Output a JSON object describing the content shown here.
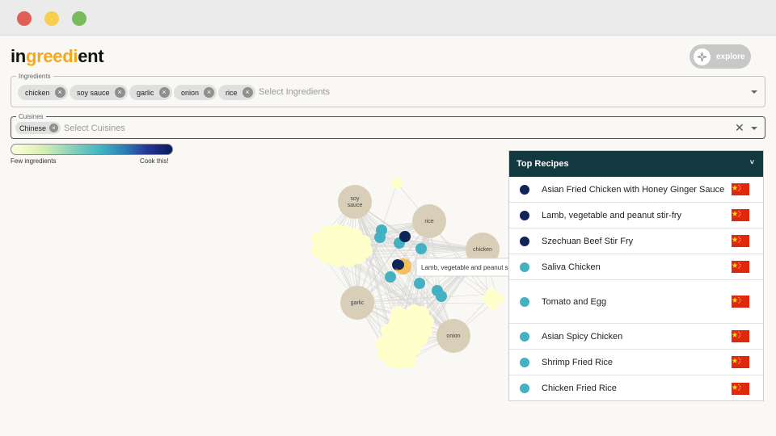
{
  "window": {
    "controls": [
      "close",
      "minimize",
      "maximize"
    ]
  },
  "logo": {
    "part1": "in",
    "part2": "greedi",
    "part3": "ent"
  },
  "explore_button": {
    "label": "explore",
    "icon": "sparkle-icon"
  },
  "ingredients": {
    "legend": "Ingredients",
    "chips": [
      "chicken",
      "soy sauce",
      "garlic",
      "onion",
      "rice"
    ],
    "placeholder": "Select Ingredients"
  },
  "cuisines": {
    "legend": "Cuisines",
    "chips": [
      "Chinese"
    ],
    "placeholder": "Select Cuisines"
  },
  "color_legend": {
    "low_label": "Few ingredients",
    "high_label": "Cook this!"
  },
  "graph": {
    "ingredient_nodes": [
      "soy sauce",
      "rice",
      "chicken",
      "garlic",
      "onion"
    ],
    "tooltip": "Lamb, vegetable and peanut s"
  },
  "top_recipes": {
    "title": "Top Recipes",
    "items": [
      {
        "name": "Asian Fried Chicken with Honey Ginger Sauce",
        "color": "#0f2557"
      },
      {
        "name": "Lamb, vegetable and peanut stir-fry",
        "color": "#0f2557"
      },
      {
        "name": "Szechuan Beef Stir Fry",
        "color": "#0f2557"
      },
      {
        "name": "Saliva Chicken",
        "color": "#44b1c2"
      },
      {
        "name": "Tomato and Egg",
        "color": "#44b1c2"
      },
      {
        "name": "Asian Spicy Chicken",
        "color": "#44b1c2"
      },
      {
        "name": "Shrimp Fried Rice",
        "color": "#44b1c2"
      },
      {
        "name": "Chicken Fried Rice",
        "color": "#44b1c2"
      }
    ]
  },
  "colors": {
    "header": "#11393f",
    "accent": "#f5a81c",
    "node": "#d9cfb8",
    "flag": "#de2910"
  }
}
